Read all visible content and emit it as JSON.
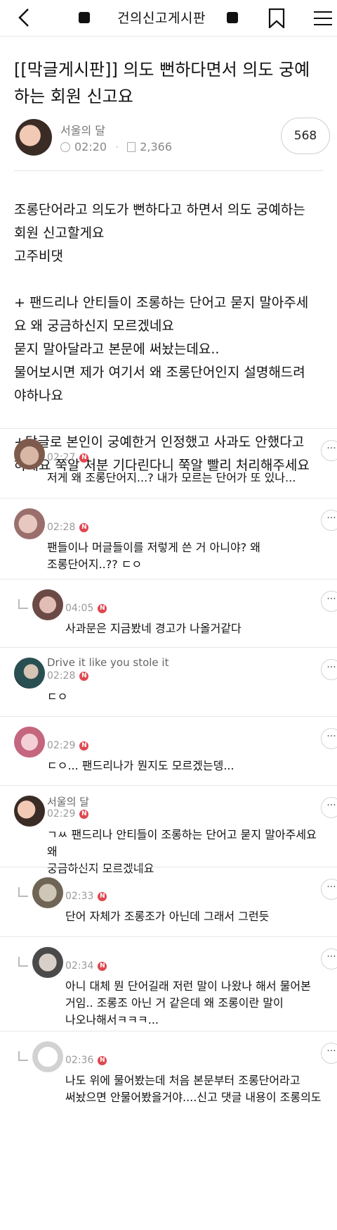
{
  "header": {
    "title": "건의신고게시판"
  },
  "post": {
    "title": "[[막글게시판]] 의도 뻔하다면서 의도 궁예하는 회원 신고요",
    "author": "서울의 달",
    "time": "02:20",
    "views": "2,366",
    "comment_count": "568",
    "paragraphs": [
      [
        "조롱단어라고 의도가 뻔하다고 하면서 의도 궁예하는",
        "회원 신고할게요",
        "고주비댓"
      ],
      [
        "+ 팬드리나 안티들이 조롱하는 단어고 묻지 말아주세",
        "요 왜 궁금하신지 모르겠네요",
        "묻지 말아달라고 본문에 써놨는데요..",
        "물어보시면 제가 여기서 왜 조롱단어인지 설명해드려",
        "야하나요"
      ],
      [
        "+답글로 본인이 궁예한거 인정했고 사과도 안했다고",
        "하네요 쭉알 처분 기다린다니 쭉알 빨리 처리해주세요"
      ]
    ]
  },
  "comments": [
    {
      "name": "",
      "time": "02:27",
      "badge": "N",
      "lines": [
        "저게 왜 조롱단어지...? 내가 모르는 단어가 또 있나..."
      ]
    },
    {
      "name": "",
      "time": "02:28",
      "badge": "N",
      "lines": [
        "팬들이나 머글들이를 저렇게 쓴 거 아니야? 왜",
        "조롱단어지..?? ㄷㅇ"
      ]
    },
    {
      "name": "",
      "time": "04:05",
      "badge": "N",
      "lines": [
        "사과문은 지금봤네 경고가 나올거같다"
      ]
    },
    {
      "name": "Drive it like you stole it",
      "time": "02:28",
      "badge": "N",
      "lines": [
        "ㄷㅇ"
      ]
    },
    {
      "name": "",
      "time": "02:29",
      "badge": "N",
      "lines": [
        "ㄷㅇ... 팬드리나가 뭔지도 모르겠는뎅..."
      ]
    },
    {
      "name": "서울의 달",
      "time": "02:29",
      "badge": "N",
      "lines": [
        "ㄱㅆ 팬드리나 안티들이 조롱하는 단어고 묻지 말아주세요 왜",
        "궁금하신지 모르겠네요"
      ]
    },
    {
      "name": "",
      "time": "02:33",
      "badge": "N",
      "lines": [
        "단어 자체가 조롱조가 아닌데 그래서 그런듯"
      ]
    },
    {
      "name": "",
      "time": "02:34",
      "badge": "N",
      "lines": [
        "아니 대체 뭔 단어길래 저런 말이 나왔나 해서 물어본",
        "거임.. 조롱조 아닌 거 같은데 왜 조롱이란 말이",
        "나오나해서ㅋㅋㅋ..."
      ]
    },
    {
      "name": "",
      "time": "02:36",
      "badge": "N",
      "lines": [
        "나도 위에 물어봤는데 처음 본문부터 조롱단어라고",
        "써놨으면 안물어봤을거야....신고 댓글 내용이 조롱의도"
      ]
    }
  ],
  "more_label": "···"
}
